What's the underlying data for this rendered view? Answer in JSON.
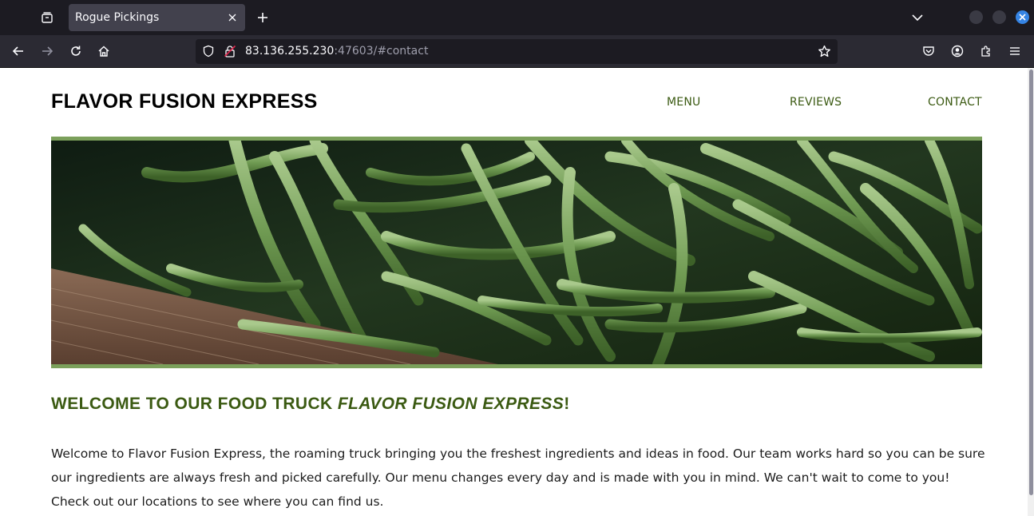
{
  "browser": {
    "tab_title": "Rogue Pickings",
    "url_host": "83.136.255.230",
    "url_rest": ":47603/#contact"
  },
  "site": {
    "title": "FLAVOR FUSION EXPRESS",
    "nav": [
      {
        "label": "MENU"
      },
      {
        "label": "REVIEWS"
      },
      {
        "label": "CONTACT"
      }
    ],
    "welcome_prefix": "WELCOME TO OUR FOOD TRUCK ",
    "welcome_name": "FLAVOR FUSION EXPRESS",
    "welcome_suffix": "!",
    "intro": "Welcome to Flavor Fusion Express, the roaming truck bringing you the freshest ingredients and ideas in food. Our team works hard so you can be sure our ingredients are always fresh and picked carefully. Our menu changes every day and is made with you in mind. We can't wait to come to you! Check out our locations to see where you can find us."
  },
  "colors": {
    "accent_green": "#3b5a12",
    "hero_border": "#7ba05b",
    "chrome_dark": "#1c1b22",
    "chrome_bar": "#2b2a33"
  }
}
